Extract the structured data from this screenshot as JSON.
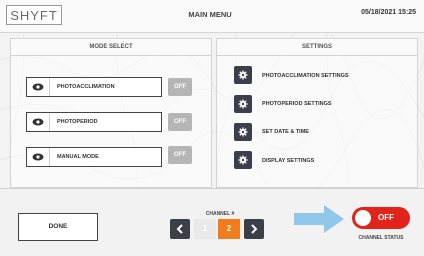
{
  "header": {
    "logo": "SHYFT",
    "title": "MAIN MENU",
    "datetime": "05/18/2021  15:25"
  },
  "mode_select": {
    "heading": "MODE SELECT",
    "items": [
      {
        "label": "PHOTOACCLIMATION",
        "state": "OFF"
      },
      {
        "label": "PHOTOPERIOD",
        "state": "OFF"
      },
      {
        "label": "MANUAL MODE",
        "state": "OFF"
      }
    ]
  },
  "settings": {
    "heading": "SETTINGS",
    "items": [
      {
        "label": "PHOTOACCLIMATION SETTINGS",
        "icon": "gear-icon"
      },
      {
        "label": "PHOTOPERIOD SETTINGS",
        "icon": "gear-icon"
      },
      {
        "label": "SET DATE & TIME",
        "icon": "gear-icon"
      },
      {
        "label": "DISPLAY SETTINGS",
        "icon": "gear-icon"
      }
    ]
  },
  "footer": {
    "done_label": "DONE",
    "channel_label": "CHANNEL #",
    "channels": [
      "1",
      "2"
    ],
    "selected_channel": "2",
    "status_toggle": "OFF",
    "status_label": "CHANNEL STATUS"
  },
  "colors": {
    "accent_orange": "#f07c1b",
    "status_red": "#e2231a",
    "button_dark": "#3b3f4a",
    "off_gray": "#b5b5b5",
    "pointer_blue": "#8fc8ea"
  }
}
